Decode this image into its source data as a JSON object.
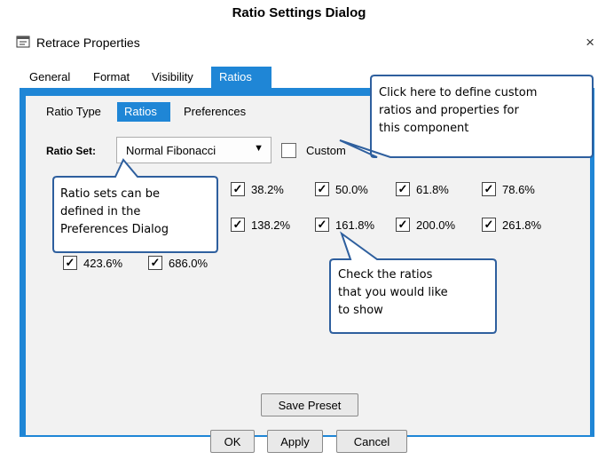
{
  "caption": "Ratio Settings Dialog",
  "window": {
    "title": "Retrace Properties",
    "close_glyph": "×"
  },
  "main_tabs": [
    "General",
    "Format",
    "Visibility",
    "Ratios"
  ],
  "active_main_tab": "Ratios",
  "sub_tabs": [
    "Ratio Type",
    "Ratios",
    "Preferences"
  ],
  "active_sub_tab": "Ratios",
  "ratio_set": {
    "label": "Ratio Set:",
    "value": "Normal Fibonacci",
    "arrow": "▼"
  },
  "custom": {
    "label": "Custom",
    "checked": false
  },
  "ratios": {
    "check_glyph": "✓",
    "row1": [
      "38.2%",
      "50.0%",
      "61.8%",
      "78.6%"
    ],
    "row2": [
      "138.2%",
      "161.8%",
      "200.0%",
      "261.8%"
    ],
    "row3": [
      "423.6%",
      "686.0%"
    ]
  },
  "buttons": {
    "save_preset": "Save Preset",
    "ok": "OK",
    "apply": "Apply",
    "cancel": "Cancel"
  },
  "callouts": {
    "custom": [
      "Click here to define custom",
      "ratios and properties for",
      "this component"
    ],
    "ratio_sets": [
      "Ratio sets can be",
      "defined in the",
      "Preferences Dialog"
    ],
    "check": [
      "Check the ratios",
      "that you would like",
      "to show"
    ]
  },
  "colors": {
    "accent": "#1f86d6",
    "callout_border": "#2e5f9e"
  }
}
